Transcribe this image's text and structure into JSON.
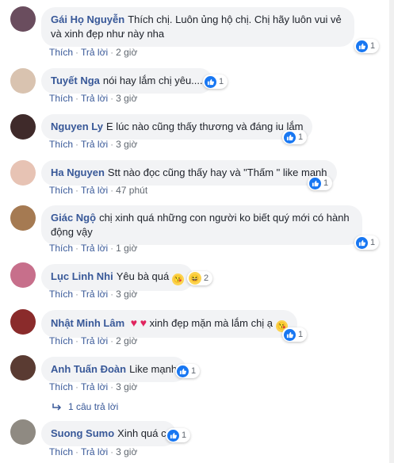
{
  "comments": [
    {
      "author": "Gái Họ Nguyễn",
      "text": "Thích chị. Luôn ủng hộ chị. Chị hãy luôn vui vẻ và xinh đẹp như này nha",
      "like_label": "Thích",
      "reply_label": "Trả lời",
      "time": "2 giờ",
      "reactions": "1",
      "avatar_color": "#6a4d5e"
    },
    {
      "author": "Tuyết Nga",
      "text": "nói hay lắm chị yêu....",
      "like_label": "Thích",
      "reply_label": "Trả lời",
      "time": "3 giờ",
      "reactions": "1",
      "avatar_color": "#d9c3b0"
    },
    {
      "author": "Nguyen Ly",
      "text": "E lúc nào cũng thấy thương và đáng iu lắm",
      "like_label": "Thích",
      "reply_label": "Trả lời",
      "time": "3 giờ",
      "reactions": "1",
      "avatar_color": "#3f2a2a"
    },
    {
      "author": "Ha Nguyen",
      "text": "Stt nào đọc cũng thấy hay và \"Thấm \" like mạnh",
      "like_label": "Thích",
      "reply_label": "Trả lời",
      "time": "47 phút",
      "reactions": "1",
      "avatar_color": "#e7c3b4"
    },
    {
      "author": "Giác Ngộ",
      "text": "chị xinh quá những con người ko biết quý mới có hành động vậy",
      "like_label": "Thích",
      "reply_label": "Trả lời",
      "time": "1 giờ",
      "reactions": "1",
      "avatar_color": "#a57a52"
    },
    {
      "author": "Lục Linh Nhi",
      "text": "Yêu bà quá",
      "like_label": "Thích",
      "reply_label": "Trả lời",
      "time": "3 giờ",
      "reactions": "2",
      "avatar_color": "#c76f8b"
    },
    {
      "author": "Nhật Minh Lâm",
      "text": "xinh đẹp mặn mà lắm chị ạ",
      "like_label": "Thích",
      "reply_label": "Trả lời",
      "time": "2 giờ",
      "reactions": "1",
      "avatar_color": "#8a2b2b"
    },
    {
      "author": "Anh Tuấn Đoàn",
      "text": "Like mạnh",
      "like_label": "Thích",
      "reply_label": "Trả lời",
      "time": "3 giờ",
      "reactions": "1",
      "avatar_color": "#5a3b32"
    },
    {
      "author": "Suong Sumo",
      "text": "Xinh quá c",
      "like_label": "Thích",
      "reply_label": "Trả lời",
      "time": "3 giờ",
      "reactions": "1",
      "avatar_color": "#8f8a82"
    }
  ],
  "replies_link": "1 câu trả lời",
  "colors": {
    "name": "#385898",
    "bubble": "#f2f3f5",
    "like": "#1877f2"
  }
}
